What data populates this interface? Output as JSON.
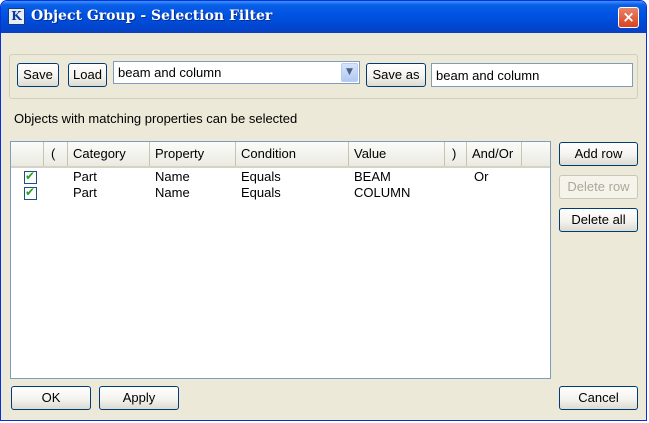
{
  "window": {
    "title": "Object Group - Selection Filter",
    "close_glyph": "×",
    "app_icon_glyph": "K"
  },
  "toolbar": {
    "save_label": "Save",
    "load_label": "Load",
    "filter_select_value": "beam and column",
    "save_as_label": "Save as",
    "save_as_value": "beam and column"
  },
  "info_text": "Objects with matching properties can be selected",
  "grid": {
    "columns": [
      "(",
      "Category",
      "Property",
      "Condition",
      "Value",
      ")",
      "And/Or"
    ],
    "rows": [
      {
        "checked": true,
        "open": "",
        "category": "Part",
        "property": "Name",
        "condition": "Equals",
        "value": "BEAM",
        "close": "",
        "and_or": "Or"
      },
      {
        "checked": true,
        "open": "",
        "category": "Part",
        "property": "Name",
        "condition": "Equals",
        "value": "COLUMN",
        "close": "",
        "and_or": ""
      }
    ]
  },
  "side_buttons": {
    "add_row": "Add row",
    "delete_row": "Delete row",
    "delete_all": "Delete all"
  },
  "footer": {
    "ok": "OK",
    "apply": "Apply",
    "cancel": "Cancel"
  },
  "colors": {
    "titlebar": "#0054e3",
    "dialog_bg": "#ece9d8",
    "check_mark": "#21a121"
  }
}
